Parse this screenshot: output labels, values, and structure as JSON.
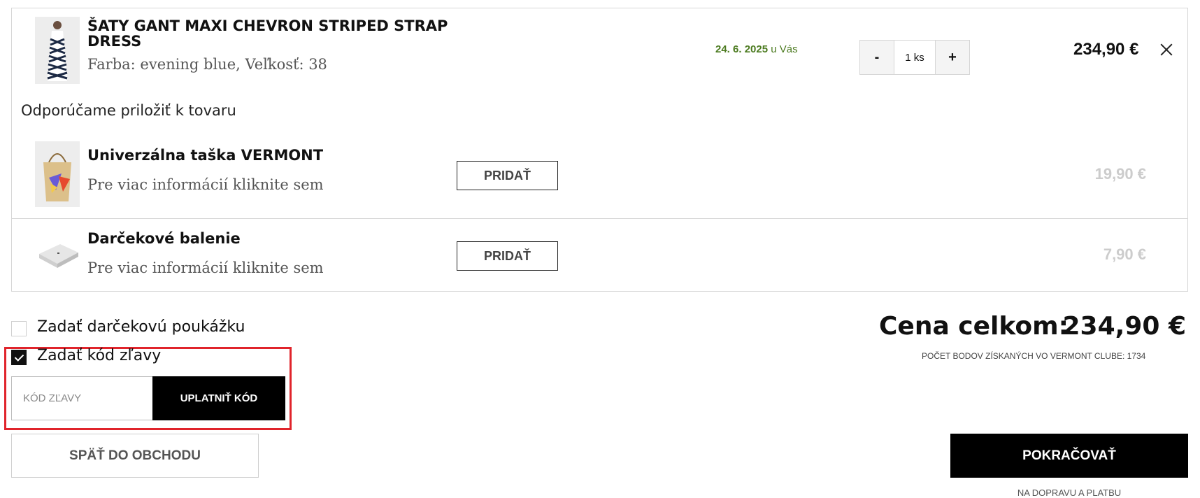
{
  "cart_item": {
    "title": "ŠATY GANT MAXI CHEVRON STRIPED STRAP DRESS",
    "attributes": "Farba: evening blue, Veľkosť: 38",
    "delivery_date": "24. 6. 2025",
    "delivery_suffix": "u Vás",
    "qty_minus": "-",
    "qty_value": "1 ks",
    "qty_plus": "+",
    "price": "234,90 €"
  },
  "recommend": {
    "heading": "Odporúčame priložiť k tovaru",
    "items": [
      {
        "title": "Univerzálna taška VERMONT",
        "subtitle": "Pre viac informácií kliknite sem",
        "button": "PRIDAŤ",
        "price": "19,90 €"
      },
      {
        "title": "Darčekové balenie",
        "subtitle": "Pre viac informácií kliknite sem",
        "button": "PRIDAŤ",
        "price": "7,90 €"
      }
    ]
  },
  "options": {
    "gift_voucher_label": "Zadať darčekovú poukážku",
    "gift_voucher_checked": false,
    "discount_label": "Zadať kód zľavy",
    "discount_checked": true,
    "discount_placeholder": "KÓD ZĽAVY",
    "apply_button": "UPLATNIŤ KÓD"
  },
  "summary": {
    "total_label": "Cena celkom:",
    "total_value": "234,90 €",
    "points_text": "POČET BODOV ZÍSKANÝCH VO VERMONT CLUBE: 1734"
  },
  "actions": {
    "back": "SPÄŤ DO OBCHODU",
    "continue": "POKRAČOVAŤ",
    "continue_sub": "NA DOPRAVU A PLATBU"
  },
  "colors": {
    "accent_green": "#4b7a1f",
    "highlight_red": "#e0242b",
    "primary_black": "#000000"
  }
}
